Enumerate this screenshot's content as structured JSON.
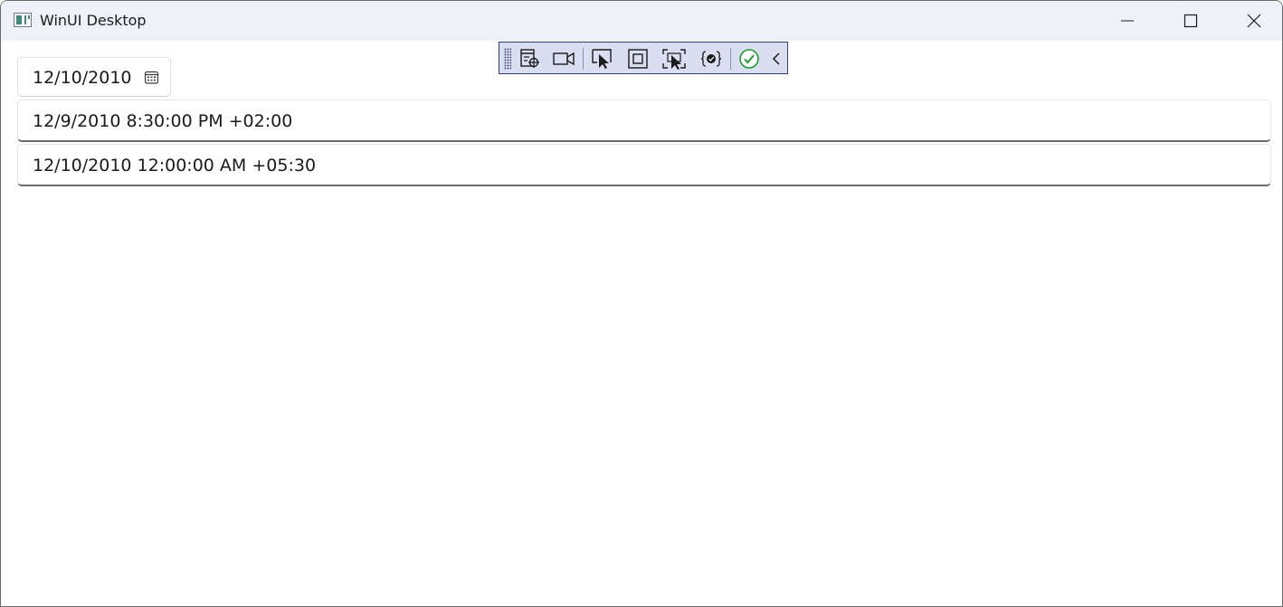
{
  "window": {
    "title": "WinUI Desktop",
    "caption_icons": [
      "minimize-icon",
      "maximize-icon",
      "close-icon"
    ]
  },
  "debug_toolbar": {
    "icons": [
      "live-visual-tree-icon",
      "record-video-icon",
      "select-element-icon",
      "display-layout-adorners-icon",
      "track-focus-icon",
      "binding-failures-icon",
      "accessibility-check-icon",
      "collapse-toolbar-icon"
    ],
    "accent_color": "#2c3c8a",
    "check_color": "#1e9e2e"
  },
  "date_picker": {
    "value": "12/10/2010",
    "icon": "calendar-icon"
  },
  "date_time_fields": [
    {
      "value": "12/9/2010 8:30:00 PM +02:00"
    },
    {
      "value": "12/10/2010 12:00:00 AM +05:30"
    }
  ]
}
